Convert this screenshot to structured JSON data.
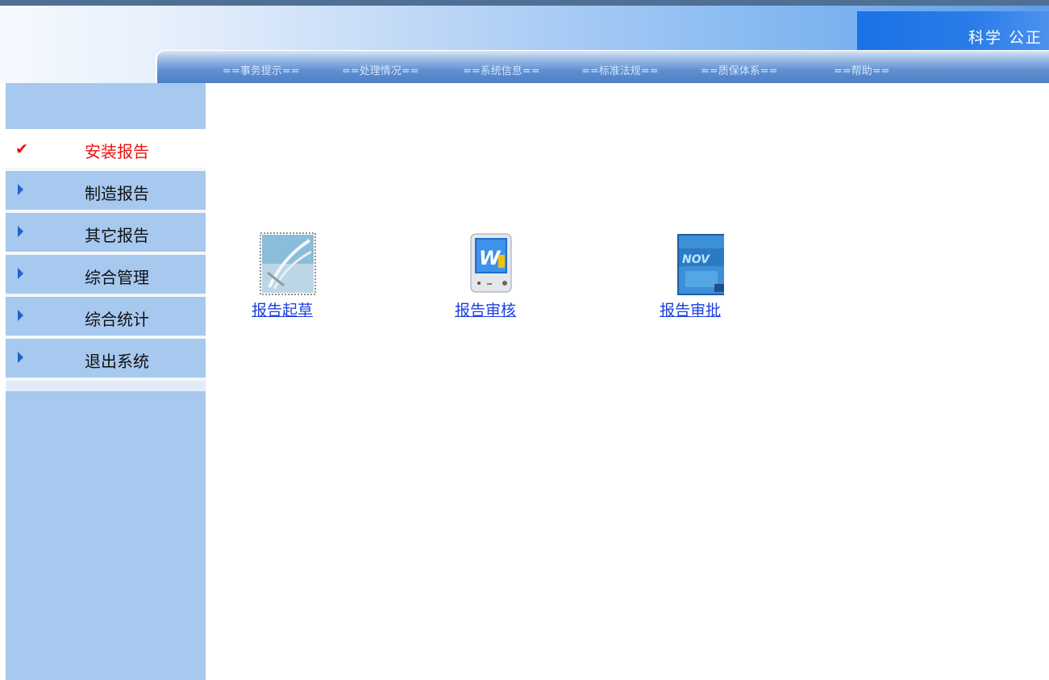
{
  "header": {
    "slogan": "科学  公正"
  },
  "nav": {
    "items": [
      "==事务提示==",
      "==处理情况==",
      "==系统信息==",
      "==标准法规==",
      "==质保体系==",
      "==帮助=="
    ]
  },
  "sidebar": {
    "items": [
      {
        "label": "安装报告",
        "icon": "check-icon",
        "active": true
      },
      {
        "label": "制造报告",
        "icon": "triangle-right-icon",
        "active": false
      },
      {
        "label": "其它报告",
        "icon": "triangle-right-icon",
        "active": false
      },
      {
        "label": "综合管理",
        "icon": "triangle-right-icon",
        "active": false
      },
      {
        "label": "综合统计",
        "icon": "triangle-right-icon",
        "active": false
      },
      {
        "label": "退出系统",
        "icon": "triangle-right-icon",
        "active": false
      }
    ]
  },
  "main": {
    "launchers": [
      {
        "label": "报告起草",
        "icon": "drafting-icon"
      },
      {
        "label": "报告审核",
        "icon": "review-monitor-icon"
      },
      {
        "label": "报告审批",
        "icon": "approval-book-icon"
      }
    ]
  },
  "colors": {
    "active_menu_text": "#ee1111",
    "link_text": "#1a3fe0",
    "sidebar_bg": "#a7c8ef",
    "nav_bar": "#4d7fc6"
  }
}
